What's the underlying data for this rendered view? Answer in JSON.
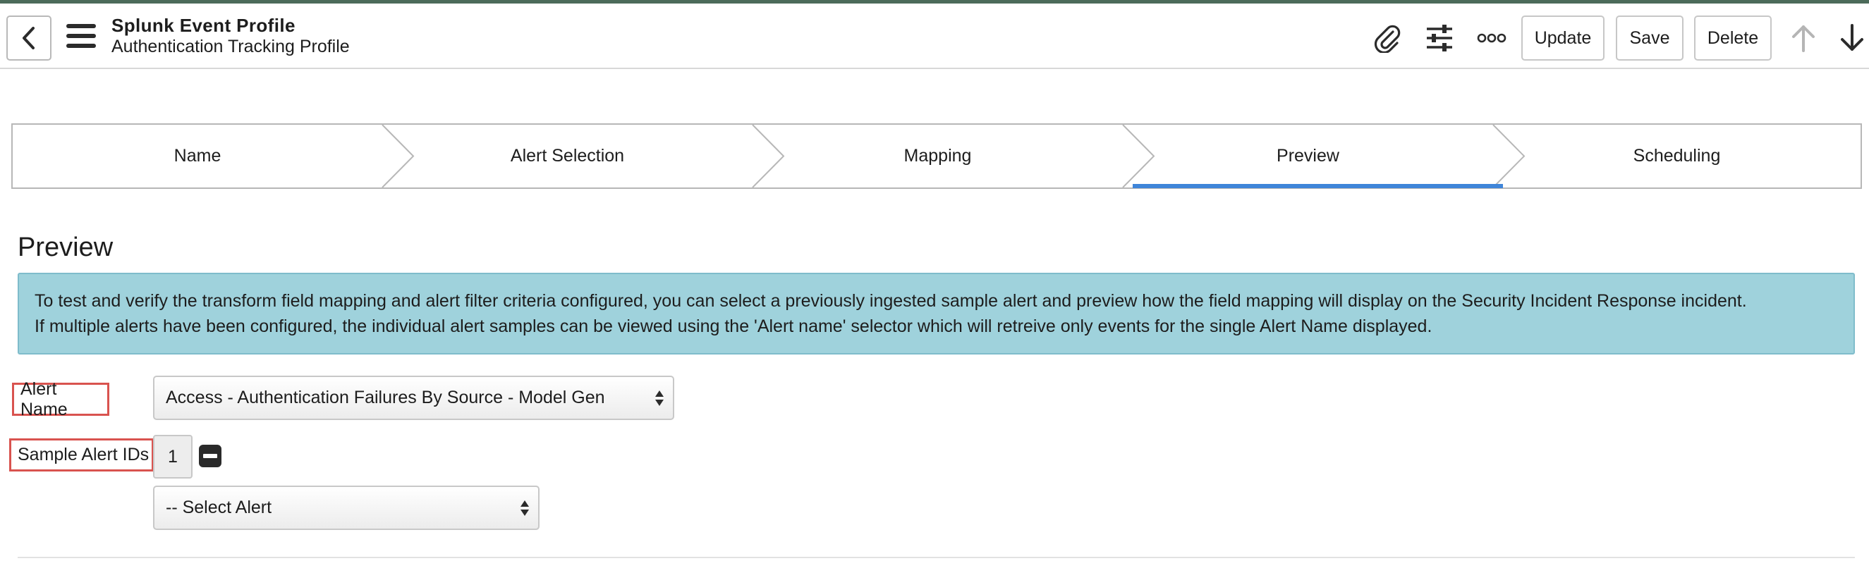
{
  "header": {
    "title": "Splunk Event Profile",
    "subtitle": "Authentication Tracking Profile",
    "buttons": {
      "update": "Update",
      "save": "Save",
      "delete": "Delete"
    },
    "icons": [
      "chevron-left-icon",
      "hamburger-menu-icon",
      "paperclip-icon",
      "sliders-icon",
      "more-options-icon",
      "arrow-up-icon",
      "arrow-down-icon"
    ]
  },
  "steps": [
    {
      "label": "Name",
      "active": false
    },
    {
      "label": "Alert Selection",
      "active": false
    },
    {
      "label": "Mapping",
      "active": false
    },
    {
      "label": "Preview",
      "active": true
    },
    {
      "label": "Scheduling",
      "active": false
    }
  ],
  "section": {
    "title": "Preview",
    "info_line1": "To test and verify the transform field mapping and alert filter criteria configured, you can select a previously ingested sample alert and preview how the field mapping will display on the Security Incident Response incident.",
    "info_line2": "If multiple alerts have been configured, the individual alert samples can be viewed using the 'Alert name' selector which will retreive only events for the single Alert Name displayed."
  },
  "form": {
    "alert_name_label": "Alert Name",
    "alert_name_value": "Access - Authentication Failures By Source - Model Gen",
    "sample_ids_label": "Sample Alert IDs",
    "sample_ids_count": "1",
    "select_alert_value": "-- Select Alert"
  },
  "colors": {
    "accent": "#3f85d9",
    "info_bg": "#9fd2dc",
    "highlight_border": "#d9534f",
    "top_bar": "#4c6b5a"
  }
}
